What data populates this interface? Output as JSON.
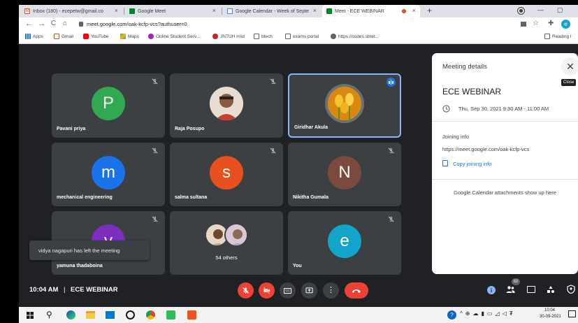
{
  "browser": {
    "tabs": [
      {
        "label": "Inbox (180) - ecepetw@gmail.co",
        "close": "×"
      },
      {
        "label": "Google Meet",
        "close": "×"
      },
      {
        "label": "Google Calendar - Week of Septe",
        "close": "×"
      },
      {
        "label": "Meet - ECE WEBINAR",
        "close": "×"
      }
    ],
    "new_tab": "+",
    "window_controls": [
      "—",
      "▢"
    ],
    "url": "meet.google.com/oak-kcfp-vcs?authuser=0",
    "profile_initial": "e",
    "bookmarks": [
      "Apps",
      "Gmail",
      "YouTube",
      "Maps",
      "Online Student Serv...",
      "JNTUH mist",
      "btech",
      "exams portal",
      "https://osdes.sbtet..."
    ],
    "reading_list": "Reading l"
  },
  "meet": {
    "participants": [
      {
        "name": "Pavani priya",
        "initial": "P",
        "color": "#33a852"
      },
      {
        "name": "Raja Posupo",
        "initial": "",
        "color": "#c9a98a"
      },
      {
        "name": "Giridhar Akula",
        "initial": "",
        "color": "#e0a020"
      },
      {
        "name": "mechanical engineering",
        "initial": "m",
        "color": "#1a73e8"
      },
      {
        "name": "salma sultana",
        "initial": "s",
        "color": "#e8501f"
      },
      {
        "name": "Nikitha Gumala",
        "initial": "N",
        "color": "#7b4a3e"
      },
      {
        "name": "yamuna thadaboina",
        "initial": "v",
        "color": "#7b2fbf"
      },
      {
        "name": "54 others",
        "initial": "",
        "color": "#999"
      },
      {
        "name": "You",
        "initial": "e",
        "color": "#12a4c9"
      }
    ],
    "toast": "vidya nagapuri has left the meeting",
    "time": "10:04 AM",
    "divider": "|",
    "meeting_title": "ECE WEBINAR",
    "participant_count": "62",
    "details": {
      "header": "Meeting details",
      "close_tooltip": "Close",
      "title": "ECE WEBINAR",
      "datetime": "Thu, Sep 30, 2021 9:30 AM - 11:00 AM",
      "joining_label": "Joining info",
      "joining_url": "https://meet.google.com/oak-kcfp-vcs",
      "copy_label": "Copy joining info",
      "attachments_note": "Google Calendar attachments show up here"
    }
  },
  "taskbar": {
    "clock_time": "10:04",
    "clock_date": "30-09-2021"
  },
  "colors": {
    "meet_bg": "#202124",
    "tile_bg": "#3c4043",
    "hangup": "#ea4335",
    "accent_blue": "#1a73e8"
  }
}
